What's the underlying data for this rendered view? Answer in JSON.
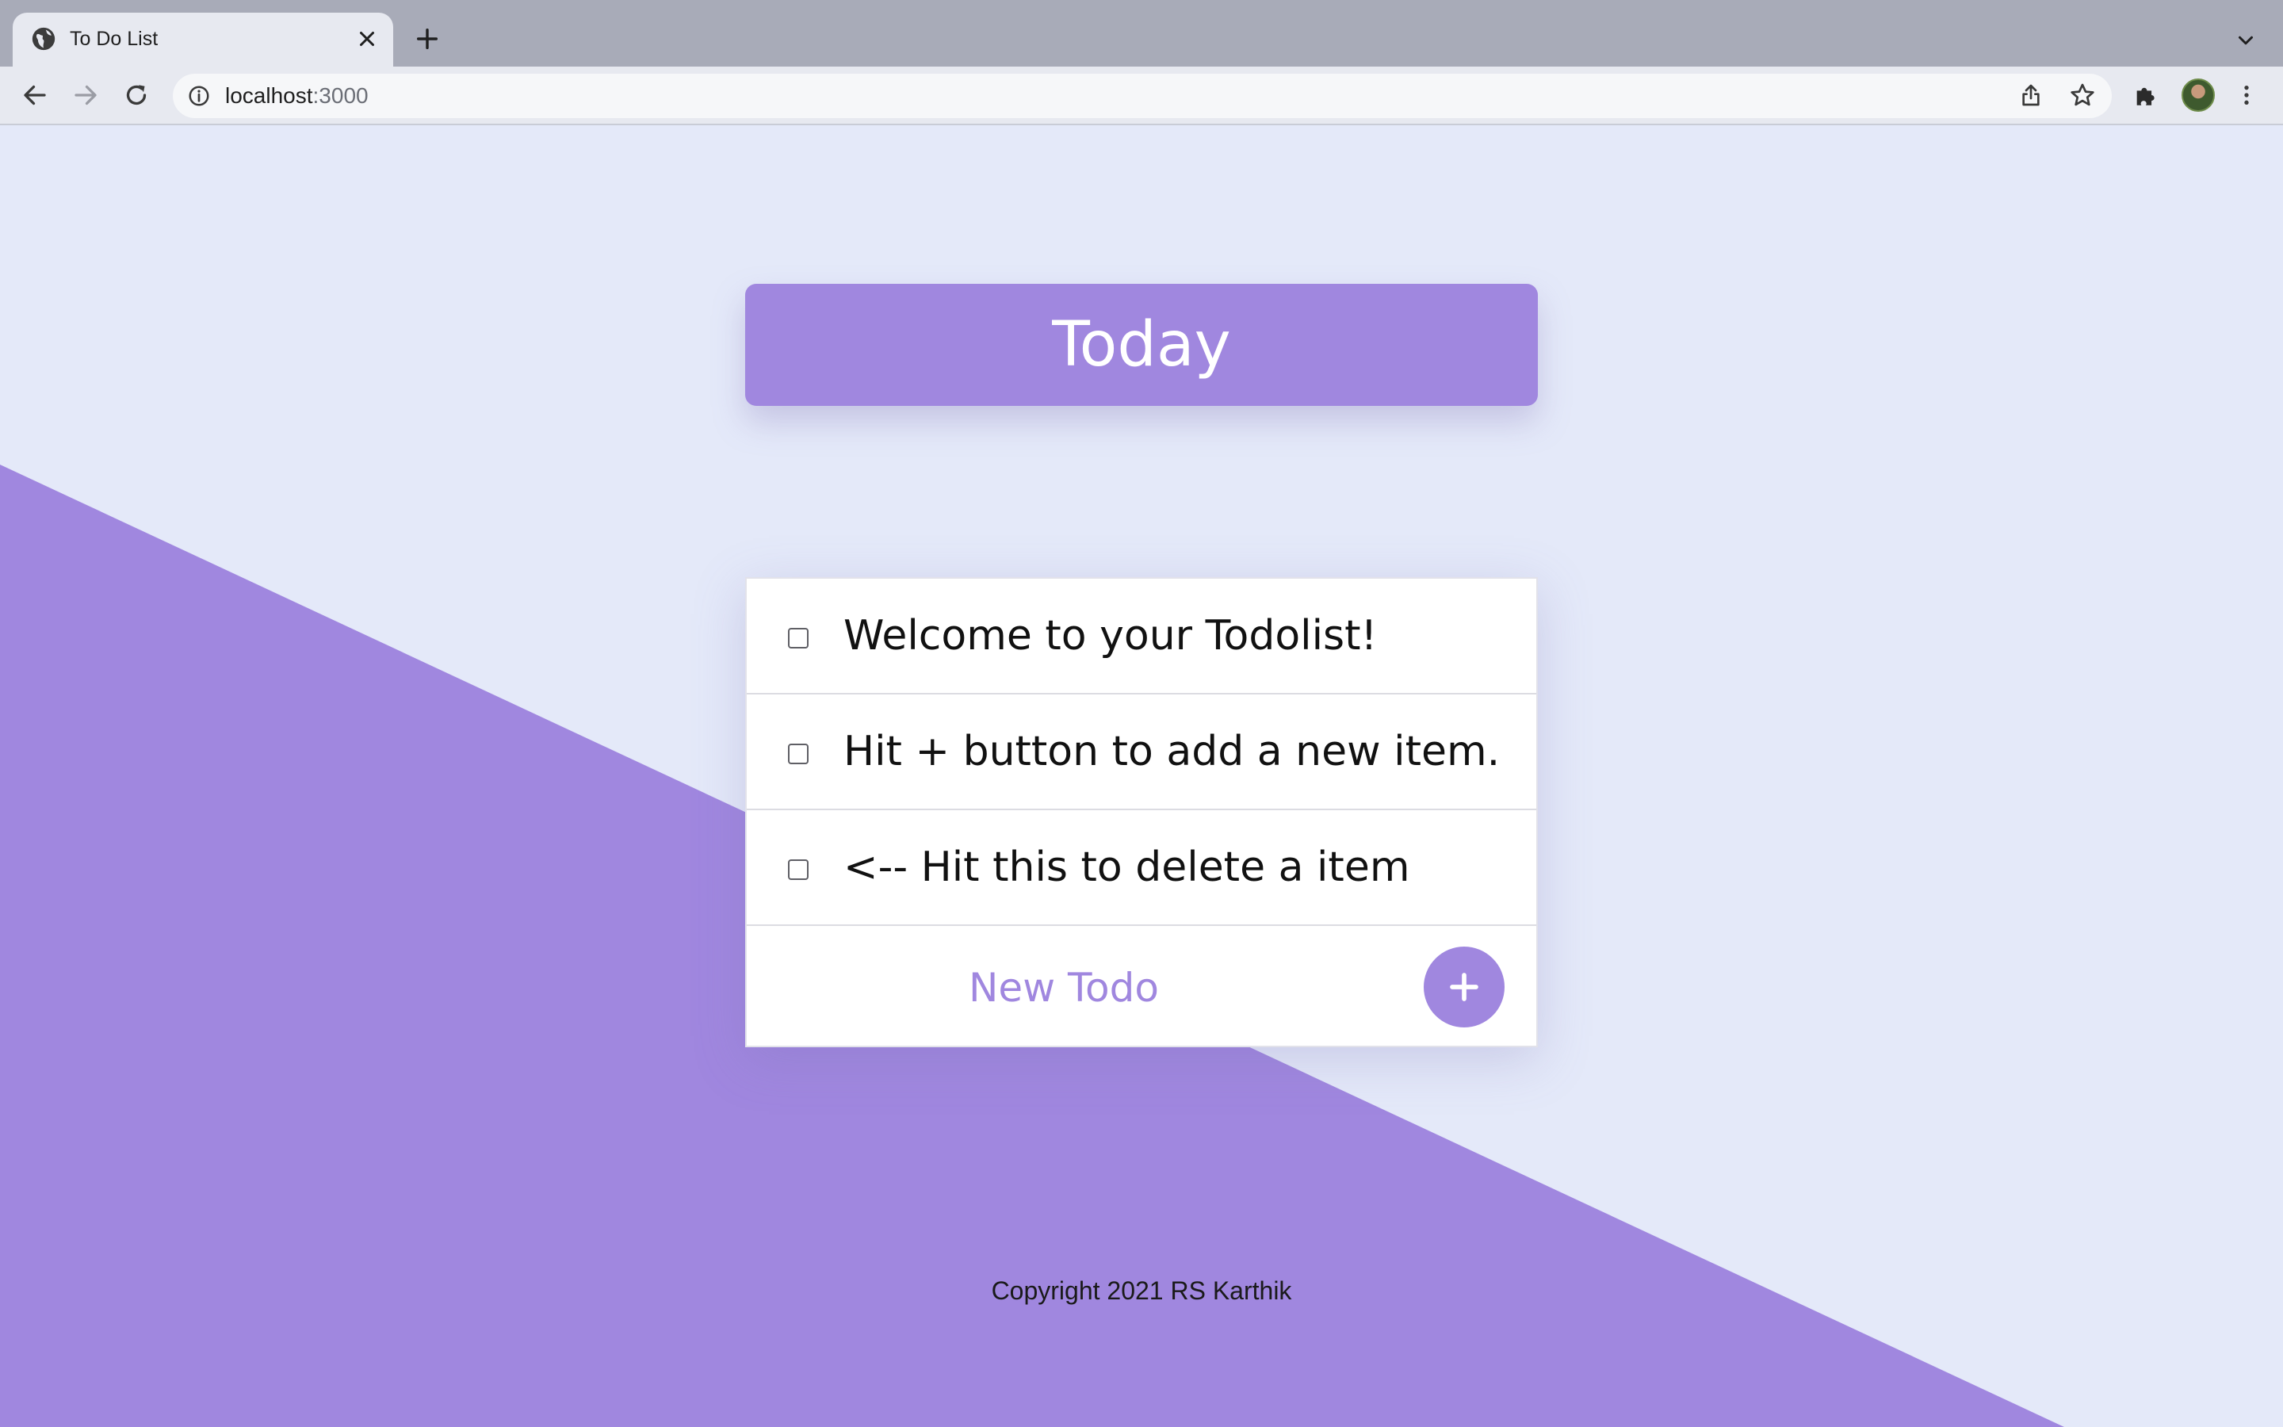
{
  "browser": {
    "tab_title": "To Do List",
    "url_host": "localhost",
    "url_port": ":3000",
    "icons": [
      "globe-icon",
      "close-icon",
      "plus-icon",
      "chevron-down-icon",
      "back-arrow-icon",
      "forward-arrow-icon",
      "reload-icon",
      "info-icon",
      "share-icon",
      "star-icon",
      "puzzle-icon",
      "avatar",
      "more-vert-icon"
    ]
  },
  "app": {
    "header_title": "Today",
    "items": [
      {
        "text": "Welcome to your Todolist!",
        "checked": false
      },
      {
        "text": "Hit + button to add a new item.",
        "checked": false
      },
      {
        "text": "<-- Hit this to delete a item",
        "checked": false
      }
    ],
    "new_item_placeholder": "New Todo",
    "add_button_label": "+",
    "footer": "Copyright 2021 RS Karthik"
  },
  "colors": {
    "accent": "#A087DF",
    "background": "#E4E9F9",
    "card": "#FFFFFF"
  }
}
